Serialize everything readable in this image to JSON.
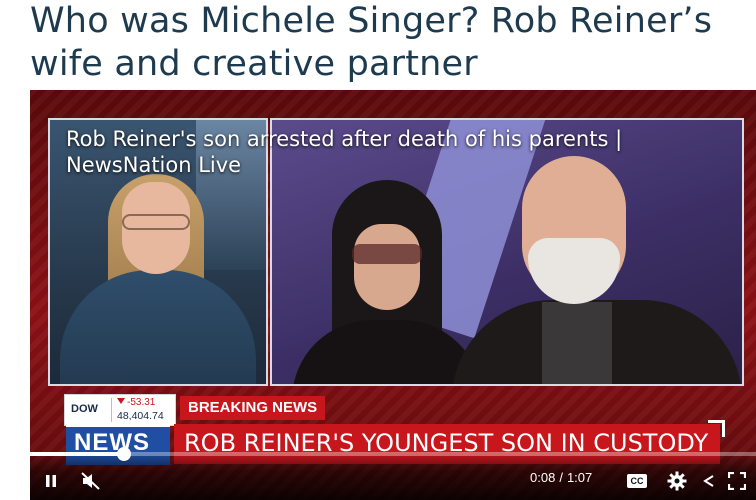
{
  "article": {
    "headline": "Who was Michele Singer? Rob Reiner’s wife and creative partner"
  },
  "video": {
    "title": "Rob Reiner's son arrested after death of his parents | NewsNation Live",
    "ticker": {
      "name": "DOW",
      "change": "-53.31",
      "value": "48,404.74",
      "change_color": "#c8161d"
    },
    "breaking_label": "BREAKING NEWS",
    "logo_text": "NEWS",
    "lower_third": "ROB REINER'S YOUNGEST SON IN CUSTODY",
    "colors": {
      "accent_red": "#c8161d",
      "logo_blue": "#1f4ea3"
    }
  },
  "controls": {
    "current_time": "0:08",
    "separator": "/",
    "duration": "1:07",
    "progress": 0.13,
    "cc_label": "CC",
    "icons": [
      "pause-icon",
      "muted-icon",
      "cc-icon",
      "settings-icon",
      "share-icon",
      "fullscreen-icon"
    ]
  }
}
